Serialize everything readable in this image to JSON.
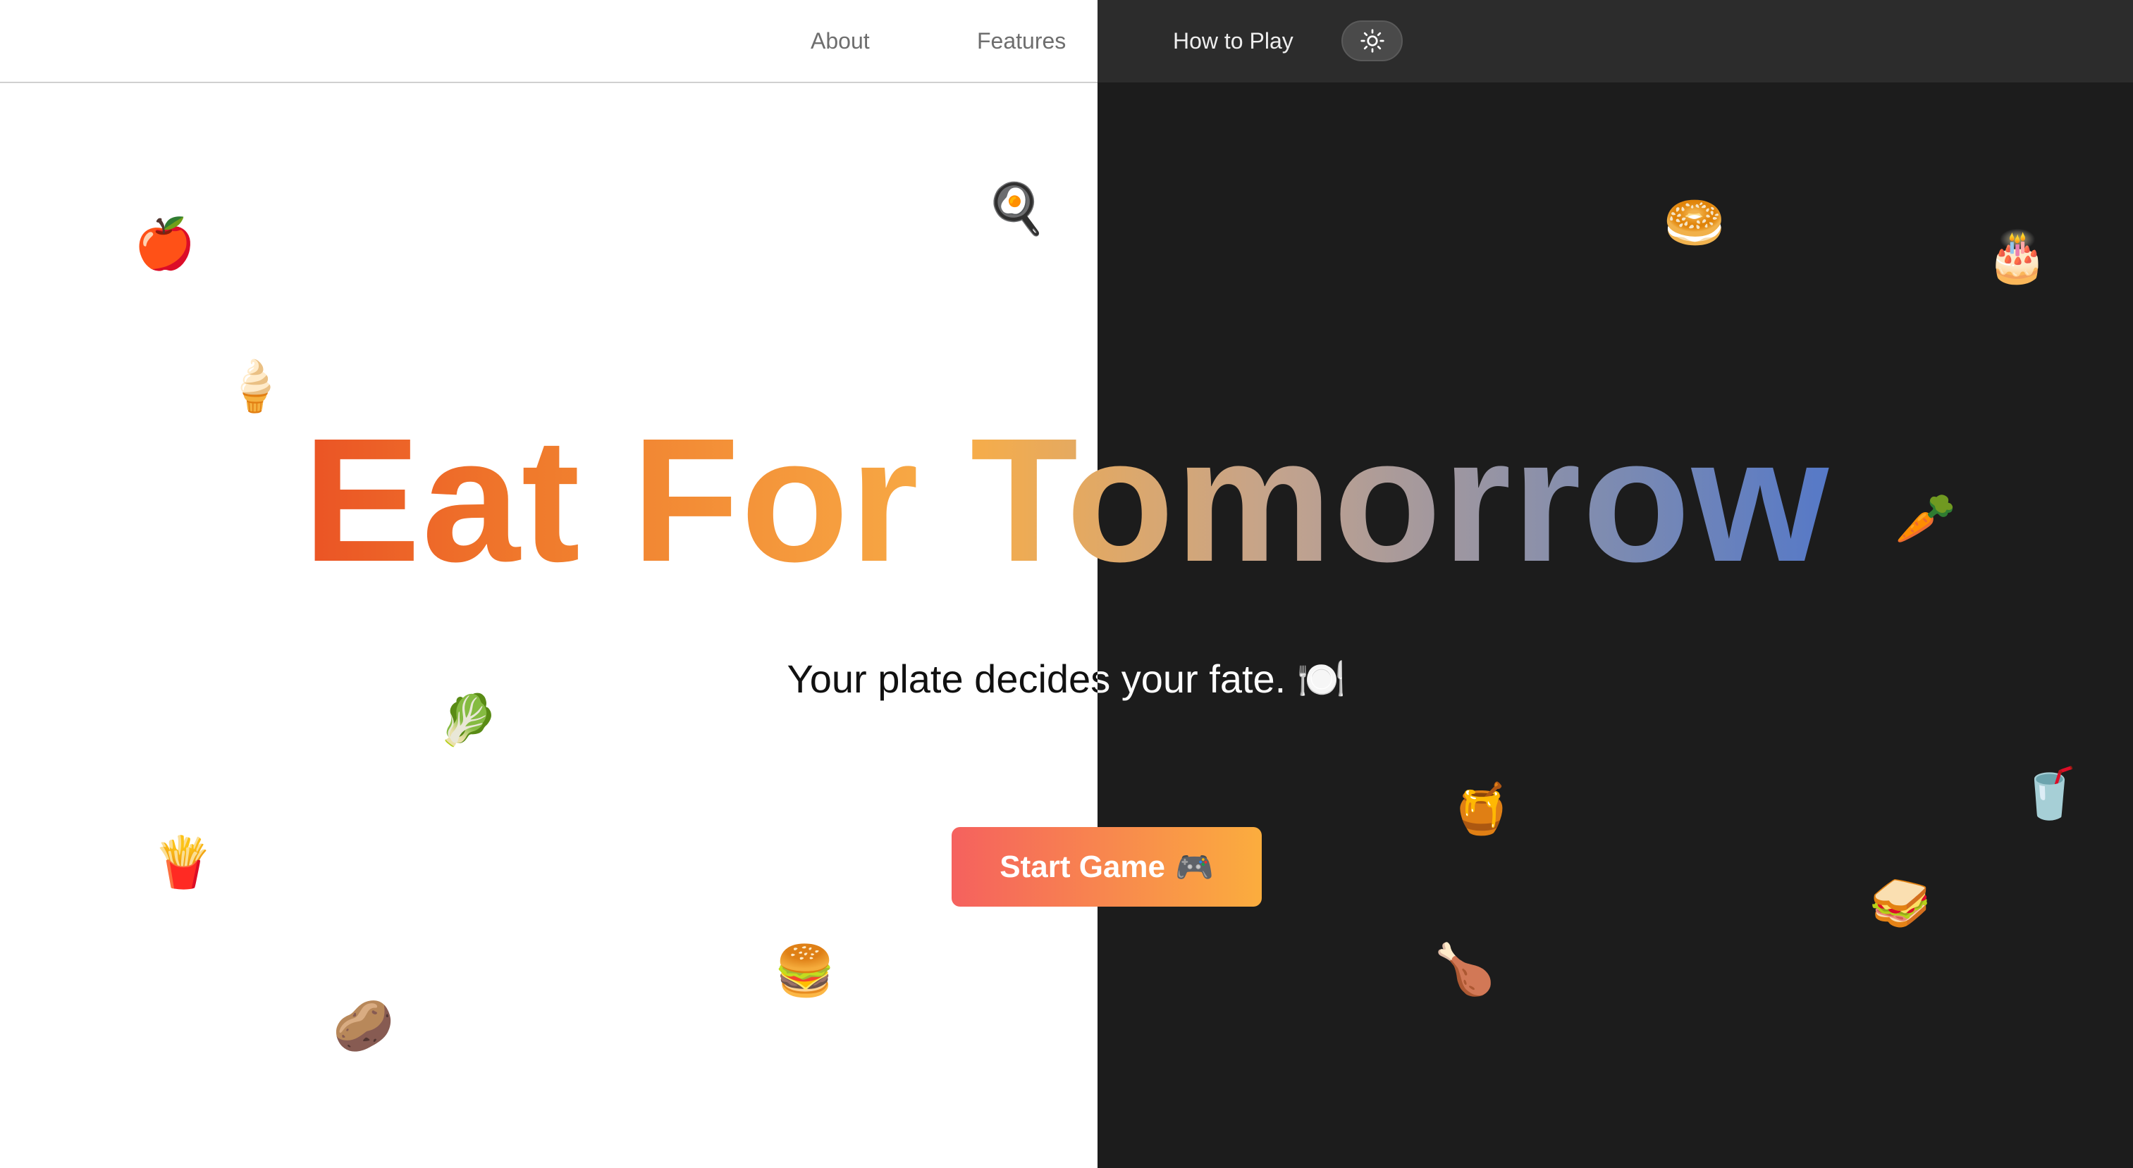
{
  "nav": {
    "about": "About",
    "features": "Features",
    "how_to_play": "How to Play",
    "theme_toggle_icon": "sun-icon"
  },
  "hero": {
    "title": "Eat For Tomorrow",
    "tagline": "Your plate decides your fate. 🍽️",
    "start_button": "Start Game",
    "start_button_icon": "🎮"
  },
  "floating_foods": [
    {
      "name": "apple",
      "glyph": "🍎"
    },
    {
      "name": "ice-cream",
      "glyph": "🍦"
    },
    {
      "name": "fried-egg",
      "glyph": "🍳"
    },
    {
      "name": "bagel",
      "glyph": "🥯"
    },
    {
      "name": "birthday-cake",
      "glyph": "🎂"
    },
    {
      "name": "carrot",
      "glyph": "🥕"
    },
    {
      "name": "lettuce",
      "glyph": "🥬"
    },
    {
      "name": "french-fries",
      "glyph": "🍟"
    },
    {
      "name": "burger",
      "glyph": "🍔"
    },
    {
      "name": "potato",
      "glyph": "🥔"
    },
    {
      "name": "honey-pot",
      "glyph": "🍯"
    },
    {
      "name": "chicken-leg",
      "glyph": "🍗"
    },
    {
      "name": "sandwich",
      "glyph": "🥪"
    },
    {
      "name": "soft-drink",
      "glyph": "🥤"
    }
  ],
  "colors": {
    "dark_bg": "#1c1c1c",
    "title_gradient": [
      "#e3201b",
      "#f07a2c",
      "#f8ad47",
      "#c3a38d",
      "#7f8cb0",
      "#1f5fe6"
    ],
    "button_gradient": [
      "#f5615e",
      "#fbad3e"
    ]
  }
}
